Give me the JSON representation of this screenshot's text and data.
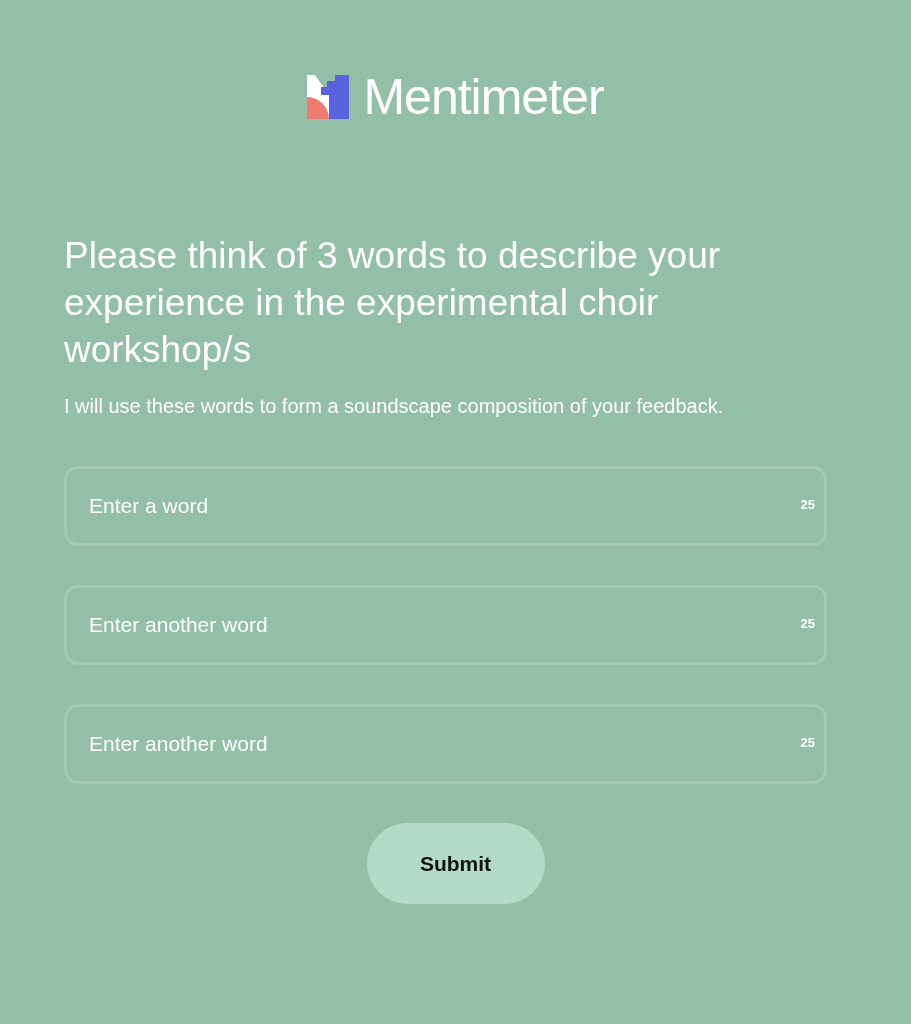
{
  "logo": {
    "text": "Mentimeter"
  },
  "question": {
    "title": "Please think of 3 words to describe your experience in the experimental choir workshop/s",
    "description": "I will use these words to form a soundscape composition of your feedback."
  },
  "fields": [
    {
      "placeholder": "Enter a word",
      "counter": "25"
    },
    {
      "placeholder": "Enter another word",
      "counter": "25"
    },
    {
      "placeholder": "Enter another word",
      "counter": "25"
    }
  ],
  "submit_button": "Submit"
}
